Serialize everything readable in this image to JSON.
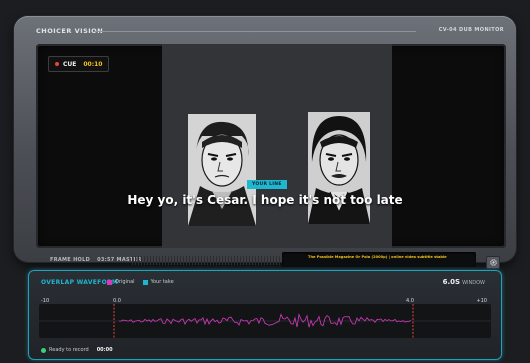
{
  "monitor": {
    "brand": "CHOICER VISION",
    "model": "CV-04 DUB MONITOR",
    "cue_label": "CUE",
    "cue_time": "00:10",
    "your_line_label": "YOUR LINE",
    "subtitle": "Hey yo, it's Cesar. I hope it's not too late",
    "frame_hold": "FRAME HOLD",
    "master_time": "03:57 MASTER",
    "caption_credit": "The Possible Magazine Or Polo (2000p) | online video subtitle stable"
  },
  "waveform": {
    "title": "OVERLAP WAVEFORM",
    "legend": [
      {
        "label": "Original",
        "color": "#d63ac1"
      },
      {
        "label": "Your take",
        "color": "#1fb6d0"
      }
    ],
    "window_value": "6.0S",
    "window_label": "WINDOW",
    "scale_left": "-10",
    "scale_start": "0.0",
    "scale_end": "4.0",
    "scale_right": "+10",
    "status_text": "Ready to record",
    "status_time": "00:00"
  },
  "colors": {
    "accent": "#1fb6d0",
    "original": "#d63ac1",
    "marker": "#e8453c",
    "timecode": "#f5c518"
  },
  "icons": {
    "record": "record-dot-icon",
    "settings": "gear-icon",
    "status": "status-dot-icon"
  }
}
